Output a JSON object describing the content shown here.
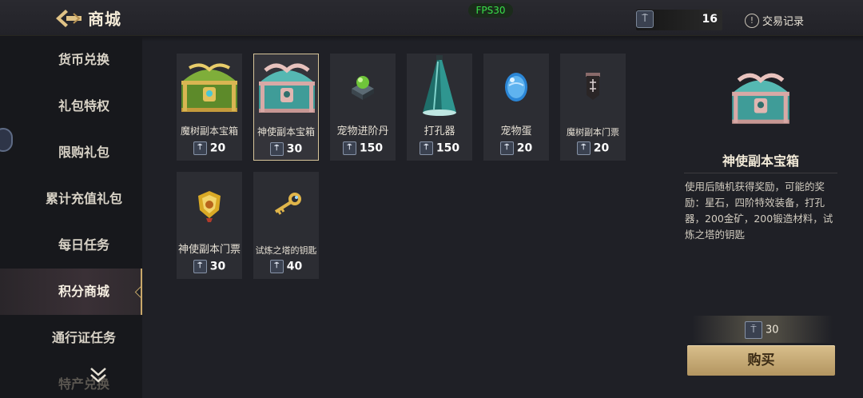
{
  "header": {
    "title": "商城",
    "fps": "FPS30",
    "currency_icon": "tower-token-icon",
    "currency_amount": "16",
    "record_label": "交易记录",
    "accent": "#c9a86a"
  },
  "sidebar": {
    "items": [
      {
        "label": "货币兑换",
        "active": false
      },
      {
        "label": "礼包特权",
        "active": false
      },
      {
        "label": "限购礼包",
        "active": false
      },
      {
        "label": "累计充值礼包",
        "active": false
      },
      {
        "label": "每日任务",
        "active": false
      },
      {
        "label": "积分商城",
        "active": true
      },
      {
        "label": "通行证任务",
        "active": false
      },
      {
        "label": "特产兑换",
        "active": false
      }
    ]
  },
  "items": [
    {
      "name": "魔树副本宝箱",
      "price": "20",
      "icon": "green-gold-chest-icon"
    },
    {
      "name": "神使副本宝箱",
      "price": "30",
      "icon": "pink-teal-chest-icon",
      "selected": true
    },
    {
      "name": "宠物进阶丹",
      "price": "150",
      "icon": "green-orb-on-pedestal-icon"
    },
    {
      "name": "打孔器",
      "price": "150",
      "icon": "cone-drill-icon"
    },
    {
      "name": "宠物蛋",
      "price": "20",
      "icon": "blue-egg-icon"
    },
    {
      "name": "魔树副本门票",
      "price": "20",
      "icon": "dark-banner-ticket-icon"
    },
    {
      "name": "神使副本门票",
      "price": "30",
      "icon": "gold-shield-ticket-icon"
    },
    {
      "name": "试炼之塔的钥匙",
      "price": "40",
      "icon": "golden-key-icon"
    }
  ],
  "detail": {
    "title": "神使副本宝箱",
    "description": "使用后随机获得奖励，可能的奖励：星石，四阶特效装备，打孔器，200金矿，200锻造材料，试炼之塔的钥匙",
    "price": "30",
    "buy_label": "购买"
  }
}
